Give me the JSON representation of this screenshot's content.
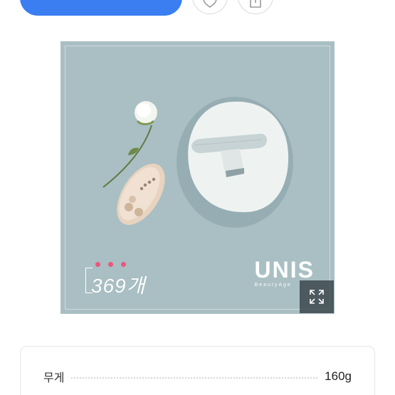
{
  "top_bar": {
    "cta_label": "",
    "cta_chevron": "›"
  },
  "product_image": {
    "overlay_count": "369개",
    "brand_name": "UNIS",
    "brand_tagline": "BeautyAge"
  },
  "specs": [
    {
      "label": "무게",
      "value": "160g"
    }
  ],
  "icons": {
    "heart": "heart-icon",
    "share": "share-icon",
    "expand": "expand-icon"
  },
  "colors": {
    "accent": "#3a7ef2",
    "image_bg": "#a9bfc4",
    "dot_pink": "#e9587a"
  }
}
